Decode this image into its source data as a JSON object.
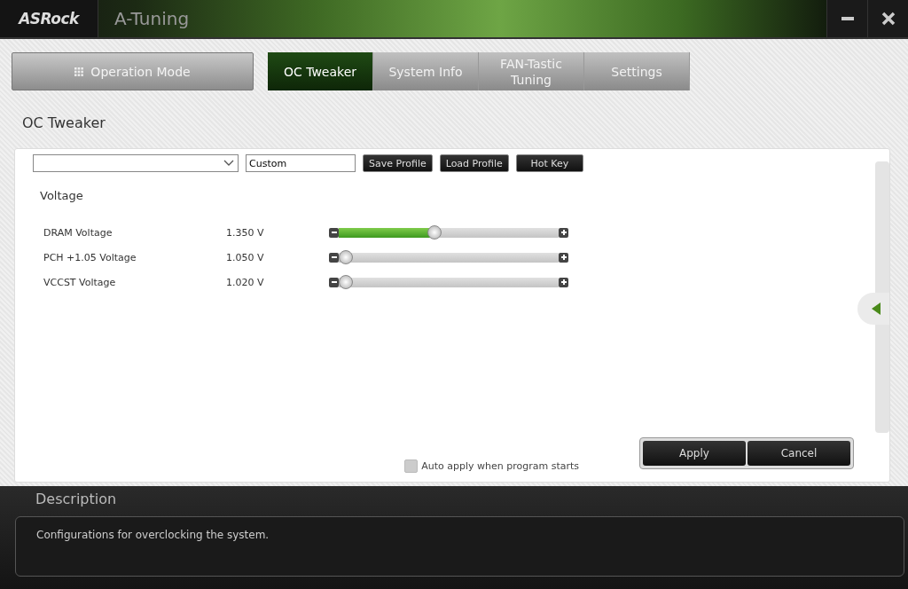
{
  "window": {
    "logo": "ASRock",
    "title": "A-Tuning"
  },
  "mode_button": {
    "label": "Operation Mode"
  },
  "tabs": [
    {
      "label": "OC Tweaker",
      "selected": true
    },
    {
      "label": "System Info",
      "selected": false
    },
    {
      "label": "FAN-Tastic Tuning",
      "selected": false
    },
    {
      "label": "Settings",
      "selected": false
    }
  ],
  "page_title": "OC Tweaker",
  "profile_bar": {
    "name_field": {
      "value": "Custom"
    },
    "buttons": [
      "Save Profile",
      "Load Profile",
      "Hot Key"
    ]
  },
  "section": {
    "title": "Voltage",
    "rows": [
      {
        "name": "DRAM Voltage",
        "reading": "1.350 V",
        "level": 0.43
      },
      {
        "name": "PCH +1.05 Voltage",
        "reading": "1.050 V",
        "level": 0
      },
      {
        "name": "VCCST Voltage",
        "reading": "1.020 V",
        "level": 0
      }
    ]
  },
  "auto_apply": {
    "label": "Auto apply when program starts",
    "checked": false
  },
  "actions": [
    "Apply",
    "Cancel"
  ],
  "description": {
    "title": "Description",
    "text": "Configurations for overclocking the system."
  }
}
